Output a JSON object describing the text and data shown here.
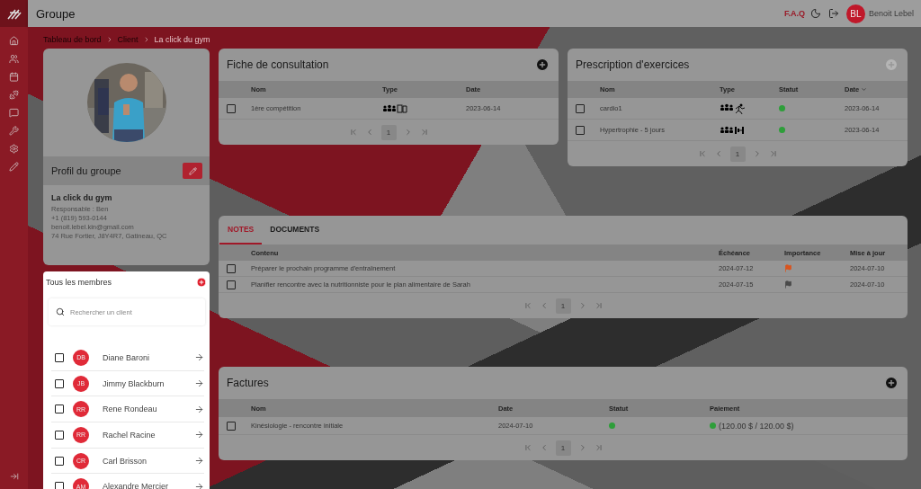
{
  "header": {
    "title": "Groupe",
    "faq": "F.A.Q",
    "user": {
      "initials": "BL",
      "name": "Benoit Lebel"
    }
  },
  "breadcrumb": [
    "Tableau de bord",
    "Client",
    "La click du gym"
  ],
  "profile": {
    "title": "Profil du groupe",
    "name": "La click du gym",
    "details": [
      "Responsable : Ben",
      "+1 (819) 593-0144",
      "benoit.lebel.kin@gmail.com",
      "74 Rue Fortier, J8Y4R7, Gatineau, QC"
    ]
  },
  "members": {
    "title": "Tous les membres",
    "search": {
      "placeholder": "Rechercher un client"
    },
    "items": [
      {
        "initials": "DB",
        "name": "Diane Baroni",
        "checked": false
      },
      {
        "initials": "JB",
        "name": "Jimmy Blackburn",
        "checked": false
      },
      {
        "initials": "RR",
        "name": "Rene Rondeau",
        "checked": false
      },
      {
        "initials": "RR",
        "name": "Rachel Racine",
        "checked": false
      },
      {
        "initials": "CR",
        "name": "Carl Brisson",
        "checked": false
      },
      {
        "initials": "AM",
        "name": "Alexandre Mercier",
        "checked": false
      }
    ]
  },
  "consultation": {
    "title": "Fiche de consultation",
    "add_button": {
      "disabled": false
    },
    "columns": [
      "Nom",
      "Type",
      "Date"
    ],
    "rows": [
      {
        "checked": false,
        "name": "1ère compétition",
        "kind": "consultation",
        "date": "2023-06-14"
      }
    ],
    "pages": [
      {
        "label": "1",
        "selected": true
      }
    ]
  },
  "prescription": {
    "title": "Prescription d'exercices",
    "add_button": {
      "disabled": true
    },
    "columns": [
      "Nom",
      "Type",
      "Statut",
      "Date"
    ],
    "rows": [
      {
        "checked": false,
        "name": "cardio1",
        "kind": "cardio",
        "color": "#2e9e3a",
        "date": "2023-06-14"
      },
      {
        "checked": false,
        "name": "Hypertrophie - 5 jours",
        "kind": "strength",
        "color": "#2e9e3a",
        "date": "2023-06-14"
      }
    ],
    "pages": [
      {
        "label": "1",
        "selected": true
      }
    ]
  },
  "notes": {
    "tabs": [
      {
        "label": "NOTES",
        "selected": true
      },
      {
        "label": "DOCUMENTS",
        "selected": false
      }
    ],
    "columns": [
      "Contenu",
      "Échéance",
      "Importance",
      "Mise à jour"
    ],
    "rows": [
      {
        "checked": false,
        "content": "Préparer le prochain programme d'entraînement",
        "due": "2024-07-12",
        "color": "#d9541e",
        "updated": "2024-07-10"
      },
      {
        "checked": false,
        "content": "Planifier rencontre avec la nutritionniste pour le plan alimentaire de Sarah",
        "due": "2024-07-15",
        "color": "#4a4a4a",
        "updated": "2024-07-10"
      }
    ],
    "pages": [
      {
        "label": "1",
        "selected": true
      }
    ]
  },
  "invoices": {
    "title": "Factures",
    "add_button": {
      "disabled": false
    },
    "columns": [
      "Nom",
      "Date",
      "Statut",
      "Paiement"
    ],
    "rows": [
      {
        "checked": false,
        "name": "Kinésiologie - rencontre initiale",
        "date": "2024-07-10",
        "status": {
          "color": "#2e9e3a"
        },
        "payment": {
          "color": "#2e9e3a",
          "text": "(120.00 $ / 120.00 $)"
        }
      }
    ],
    "pages": [
      {
        "label": "1",
        "selected": true
      }
    ]
  }
}
